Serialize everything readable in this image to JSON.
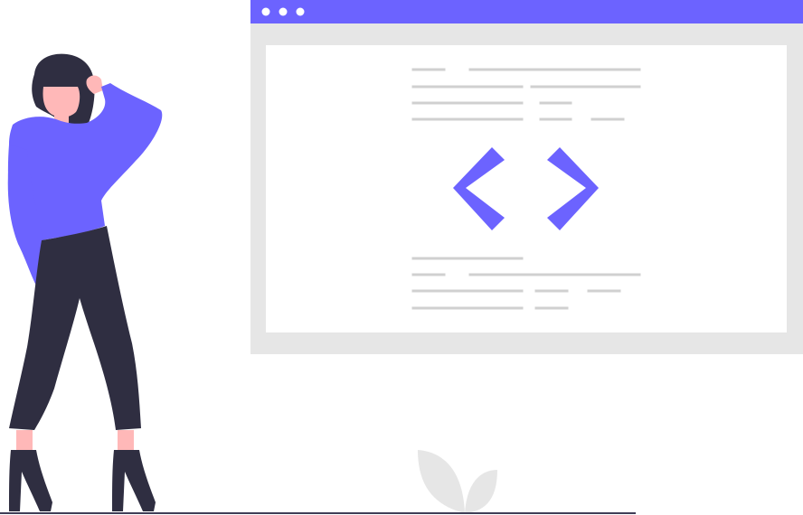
{
  "colors": {
    "accent": "#6c63ff",
    "window_frame": "#e6e6e6",
    "window_content": "#ffffff",
    "text_placeholder": "#d0d0d0",
    "dark": "#2f2e41",
    "skin": "#ffb8b8",
    "ground_line": "#3f3d56",
    "plant": "#e6e6e6"
  },
  "illustration": {
    "subject": "woman-with-code-window",
    "browser_window": {
      "titlebar_dots": [
        "dot-1",
        "dot-2",
        "dot-3"
      ],
      "code_symbol": "code-brackets-icon"
    }
  }
}
